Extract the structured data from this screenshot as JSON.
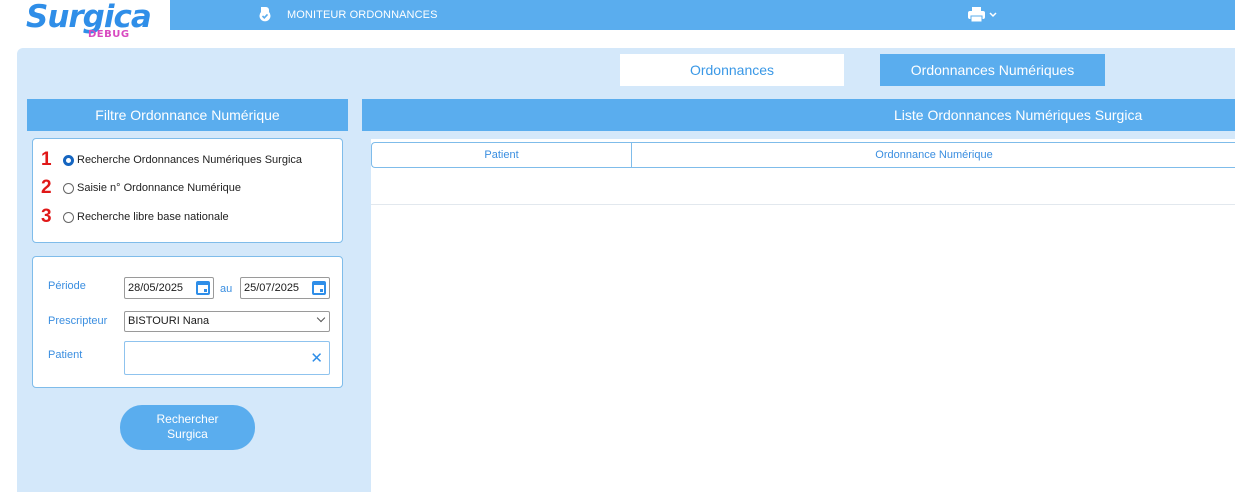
{
  "app": {
    "logo_name": "Surgica",
    "logo_badge": "DEBUG",
    "title": "MONITEUR ORDONNANCES",
    "app_icon": "pill-check-icon",
    "print_icon": "printer-icon"
  },
  "tabs": [
    {
      "label": "Ordonnances",
      "active": true
    },
    {
      "label": "Ordonnances Numériques",
      "active": false
    }
  ],
  "filter": {
    "header": "Filtre Ordonnance Numérique",
    "options": [
      {
        "number": "1",
        "label": "Recherche Ordonnances Numériques Surgica",
        "checked": true
      },
      {
        "number": "2",
        "label": "Saisie n° Ordonnance Numérique",
        "checked": false
      },
      {
        "number": "3",
        "label": "Recherche libre base nationale",
        "checked": false
      }
    ],
    "periode_label": "Période",
    "date_from": "28/05/2025",
    "date_separator": "au",
    "date_to": "25/07/2025",
    "prescripteur_label": "Prescripteur",
    "prescripteur_value": "BISTOURI Nana",
    "patient_label": "Patient",
    "patient_value": "",
    "clear_symbol": "✕",
    "search_button": "Rechercher Surgica"
  },
  "list": {
    "header": "Liste Ordonnances Numériques Surgica",
    "columns": [
      "Patient",
      "Ordonnance Numérique"
    ],
    "rows": []
  },
  "colors": {
    "accent": "#5aadee",
    "panel_bg": "#d4e8fa",
    "label_blue": "#3a8ee0",
    "number_red": "#e01818",
    "badge_pink": "#d84ac0"
  }
}
